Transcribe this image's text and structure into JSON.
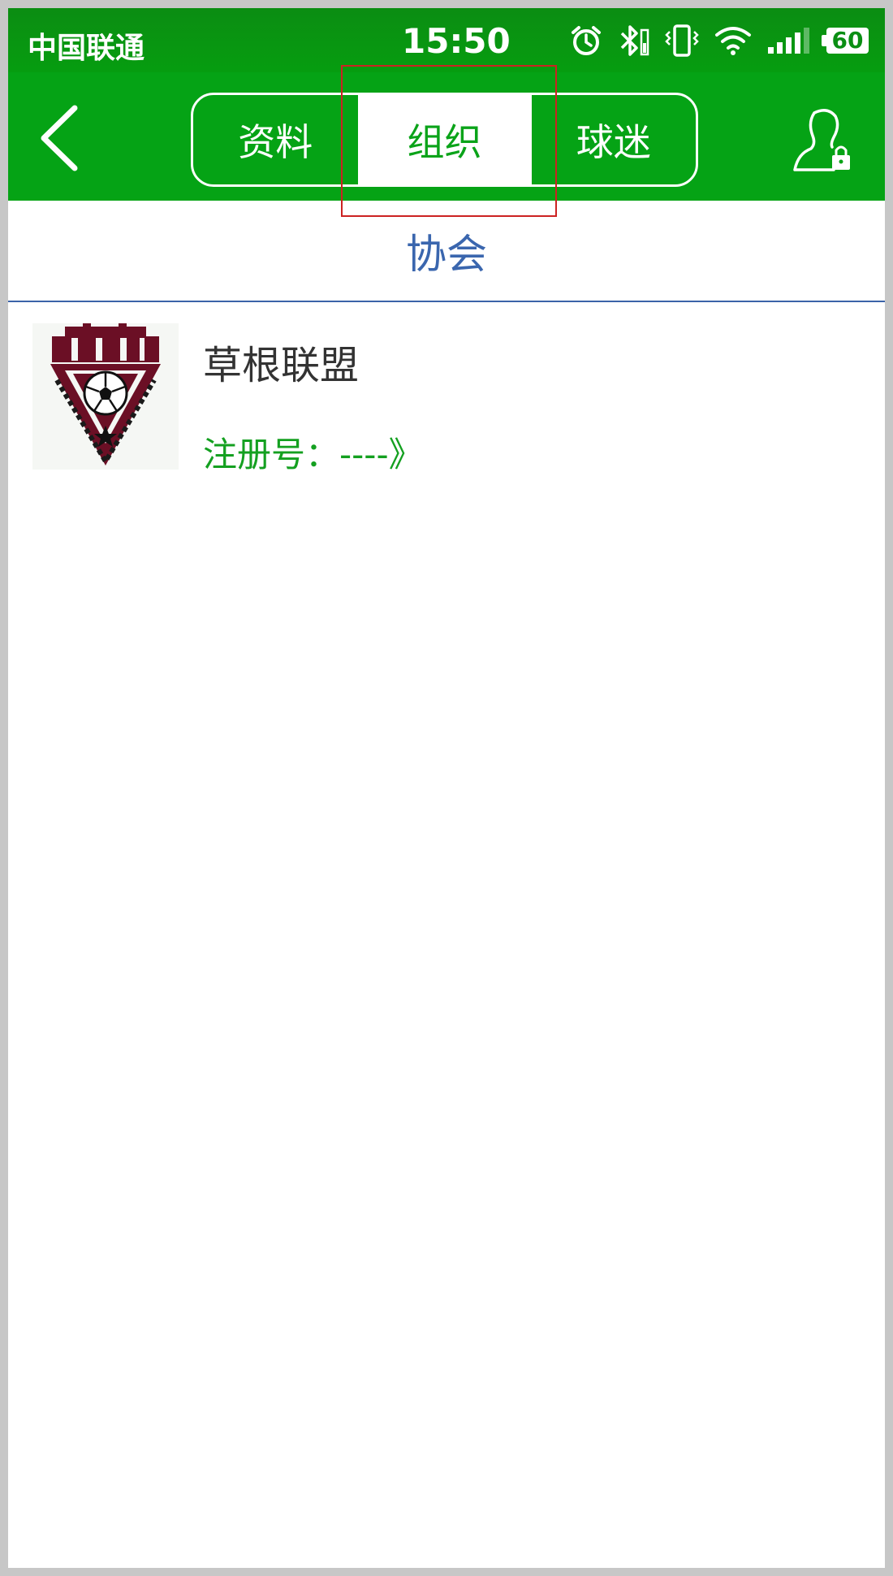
{
  "status_bar": {
    "carrier": "中国联通",
    "time": "15:50",
    "battery_level": "60",
    "icons": [
      "alarm-icon",
      "bluetooth-icon",
      "vibrate-icon",
      "wifi-icon",
      "signal-icon",
      "battery-icon"
    ]
  },
  "nav": {
    "back_icon": "chevron-left-icon",
    "tabs": [
      {
        "label": "资料",
        "active": false
      },
      {
        "label": "组织",
        "active": true
      },
      {
        "label": "球迷",
        "active": false
      }
    ],
    "right_icon": "user-lock-icon"
  },
  "section": {
    "title": "协会"
  },
  "organization": {
    "name": "草根联盟",
    "registration": "注册号：----》"
  },
  "colors": {
    "brand_green": "#05a315",
    "header_blue": "#3a66ae",
    "highlight_red": "#cc2222",
    "logo_maroon": "#6b0f25"
  }
}
